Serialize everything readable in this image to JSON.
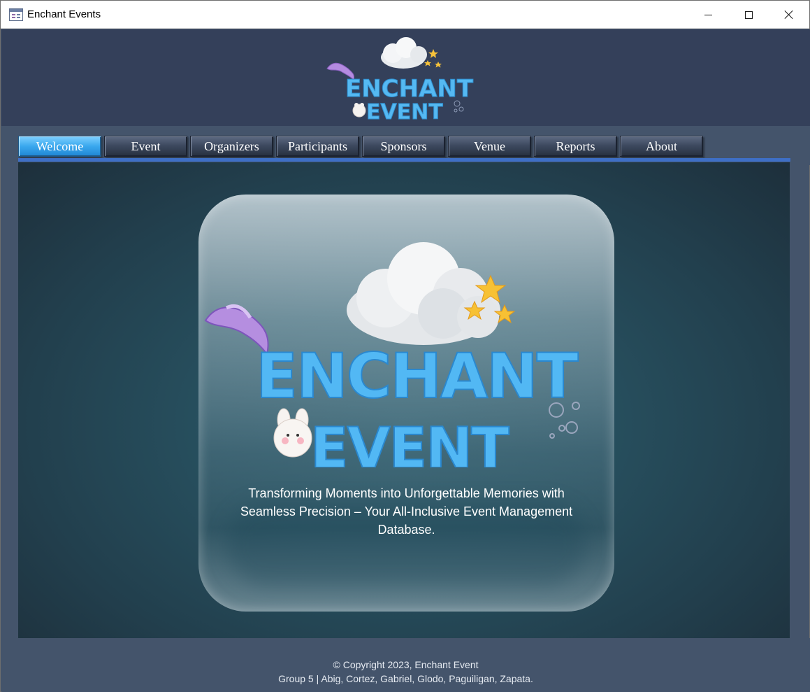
{
  "window": {
    "title": "Enchant Events"
  },
  "header": {
    "logo_line1": "ENCHANT",
    "logo_line2": "EVENT"
  },
  "nav": {
    "tabs": [
      {
        "label": "Welcome",
        "active": true
      },
      {
        "label": "Event",
        "active": false
      },
      {
        "label": "Organizers",
        "active": false
      },
      {
        "label": "Participants",
        "active": false
      },
      {
        "label": "Sponsors",
        "active": false
      },
      {
        "label": "Venue",
        "active": false
      },
      {
        "label": "Reports",
        "active": false
      },
      {
        "label": "About",
        "active": false
      }
    ]
  },
  "main": {
    "logo_line1": "ENCHANT",
    "logo_line2": "EVENT",
    "tagline": "Transforming Moments into Unforgettable Memories with Seamless Precision – Your All-Inclusive Event Management Database."
  },
  "footer": {
    "copyright": "© Copyright 2023, Enchant Event",
    "credits": "Group 5 | Abig, Cortez, Gabriel, Glodo, Paguiligan, Zapata."
  },
  "colors": {
    "logo_blue": "#4fb4f0",
    "active_tab": "#3aa8ee",
    "nav_underline": "#3e6fc6",
    "header_bg": "#34405a",
    "frame_bg": "#44546b"
  }
}
